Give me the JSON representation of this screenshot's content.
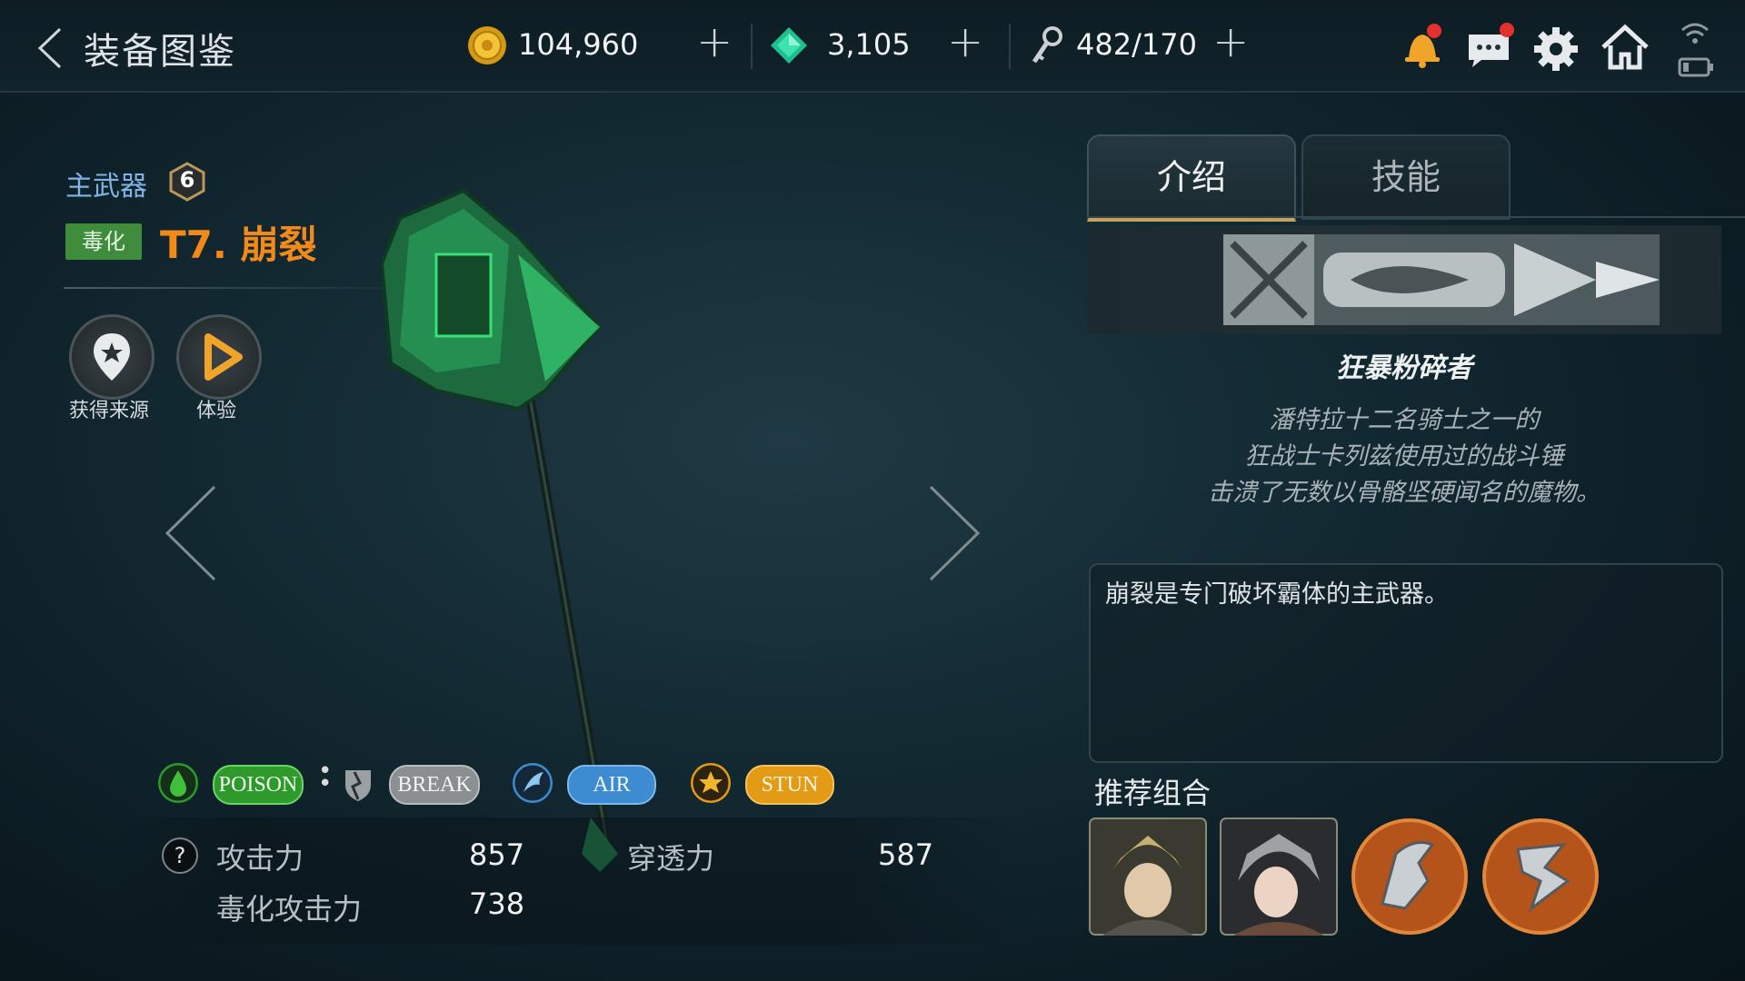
{
  "header": {
    "title": "装备图鉴",
    "gold": "104,960",
    "gems": "3,105",
    "stamina": "482/170",
    "plus": "+"
  },
  "weapon": {
    "category": "主武器",
    "level": "6",
    "element": "毒化",
    "name": "T7. 崩裂",
    "actions": [
      {
        "label": "获得来源"
      },
      {
        "label": "体验"
      }
    ],
    "tags": [
      "POISON",
      "BREAK",
      "AIR",
      "STUN"
    ],
    "stats": {
      "help": "?",
      "attack_label": "攻击力",
      "attack_value": "857",
      "pierce_label": "穿透力",
      "pierce_value": "587",
      "poison_attack_label": "毒化攻击力",
      "poison_attack_value": "738"
    }
  },
  "panel": {
    "tabs": [
      "介绍",
      "技能"
    ],
    "weapon_title": "狂暴粉碎者",
    "description": [
      "潘特拉十二名骑士之一的",
      "狂战士卡列兹使用过的战斗锤",
      "击溃了无数以骨骼坚硬闻名的魔物。"
    ],
    "info": "崩裂是专门破坏霸体的主武器。",
    "recommend_title": "推荐组合"
  },
  "colors": {
    "element_green": "#3f8c3c",
    "name_orange": "#f28a1a",
    "poison_green": "#2f9a2c",
    "break_gray": "#8a8f92",
    "air_blue": "#3d8bd1",
    "stun_orange": "#e39a14",
    "tab_accent": "#c7a25a"
  },
  "icons": [
    "back-chevron-icon",
    "gold-coin-icon",
    "gem-icon",
    "stamina-key-icon",
    "bell-icon",
    "chat-icon",
    "gear-icon",
    "home-icon",
    "wifi-icon",
    "battery-icon",
    "source-star-icon",
    "play-icon",
    "poison-drop-icon",
    "break-shield-icon",
    "air-wing-icon",
    "stun-star-icon"
  ]
}
